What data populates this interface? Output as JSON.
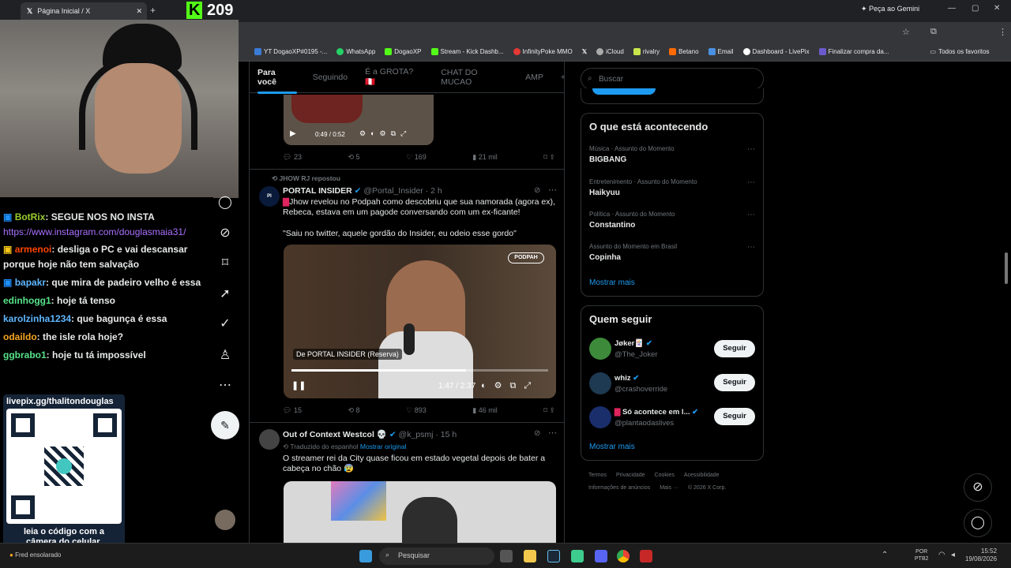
{
  "browser": {
    "tab_title": "Página Inicial / X",
    "gemini_label": "Peça ao Gemini",
    "bookmarks": [
      "YT DogaoXP#0195 -...",
      "WhatsApp",
      "DogaoXP",
      "Stream - Kick Dashb...",
      "InfinityPoke MMO",
      "",
      "iCloud",
      "rivalry",
      "Betano",
      "Email",
      "Dashboard - LivePix",
      "Finalizar compra da..."
    ],
    "bookmarks_all": "Todos os favoritos"
  },
  "stream": {
    "viewer_count": "209",
    "chat": [
      {
        "user": "BotRix",
        "msg": ": SEGUE NOS NO INSTA",
        "color": "#9acd32"
      },
      {
        "user": "",
        "msg": "https://www.instagram.com/douglasmaia31/",
        "color": "#a970ff"
      },
      {
        "user": "armenoi",
        "msg": ": desliga o PC e vai descansar",
        "color": "#ff4500"
      },
      {
        "user": "",
        "msg": "porque hoje não tem salvação",
        "color": "#fff"
      },
      {
        "user": "bapakr",
        "msg": ": que mira de padeiro velho é essa",
        "color": "#5fb7ff"
      },
      {
        "user": "edinhogg1",
        "msg": ": hoje tá tenso",
        "color": "#57e389"
      },
      {
        "user": "karolzinha1234",
        "msg": ": que bagunça é essa",
        "color": "#5fb7ff"
      },
      {
        "user": "odaildo",
        "msg": ": the isle rola hoje?",
        "color": "#f5a623"
      },
      {
        "user": "ggbrabo1",
        "msg": ": hoje tu tá impossível",
        "color": "#57e389"
      }
    ],
    "qr_url": "livepix.gg/thalitondouglas",
    "qr_caption": "leia o código com a câmera do celular.",
    "weather": "Fred ensolarado"
  },
  "x": {
    "tabs": [
      "Para você",
      "Seguindo",
      "É a GROTA? 🇵🇪",
      "CHAT DO MUCAO",
      "AMP"
    ],
    "tweet0": {
      "video_time": "0:49 / 0:52",
      "replies": "23",
      "retweets": "5",
      "likes": "169",
      "views": "21 mil"
    },
    "tweet1": {
      "repost": "JHOW RJ repostou",
      "name": "PORTAL INSIDER",
      "handle": "@Portal_Insider · 2 h",
      "text1": "Jhow revelou no Podpah como descobriu que sua namorada (agora ex), Rebeca, estava em um pagode conversando com um ex-ficante!",
      "text2": "\"Saiu no twitter, aquele gordão do Insider, eu odeio esse gordo\"",
      "video_source": "De PORTAL INSIDER (Reserva)",
      "video_time": "1:47 / 2:37",
      "replies": "15",
      "retweets": "8",
      "likes": "893",
      "views": "46 mil"
    },
    "tweet2": {
      "name": "Out of Context Westcol 💀",
      "handle": "@k_psmj · 15 h",
      "translated": "Traduzido do espanhol",
      "show_original": "Mostrar original",
      "text": "O streamer rei da City quase ficou em estado vegetal depois de bater a cabeça no chão 😰"
    },
    "search_placeholder": "Buscar",
    "trends_title": "O que está acontecendo",
    "trends": [
      {
        "category": "Música · Assunto do Momento",
        "name": "BIGBANG"
      },
      {
        "category": "Entretenimento · Assunto do Momento",
        "name": "Haikyuu"
      },
      {
        "category": "Política · Assunto do Momento",
        "name": "Constantino"
      },
      {
        "category": "Assunto do Momento em Brasil",
        "name": "Copinha"
      }
    ],
    "show_more": "Mostrar mais",
    "follow_title": "Quem seguir",
    "follow": [
      {
        "name": "Jøker🃏",
        "handle": "@The_Joker"
      },
      {
        "name": "whiz",
        "handle": "@crashoverride"
      },
      {
        "name": "Só acontece em l...",
        "handle": "@plantaodaslives"
      }
    ],
    "follow_label": "Seguir",
    "footer": [
      "Termos",
      "Privacidade",
      "Cookies",
      "Acessibilidade",
      "Informações de anúncios",
      "Mais ···",
      "© 2026 X Corp."
    ]
  },
  "taskbar": {
    "search": "Pesquisar",
    "lang1": "POR",
    "lang2": "PTB2",
    "time": "15:52",
    "date": "19/08/2026"
  }
}
